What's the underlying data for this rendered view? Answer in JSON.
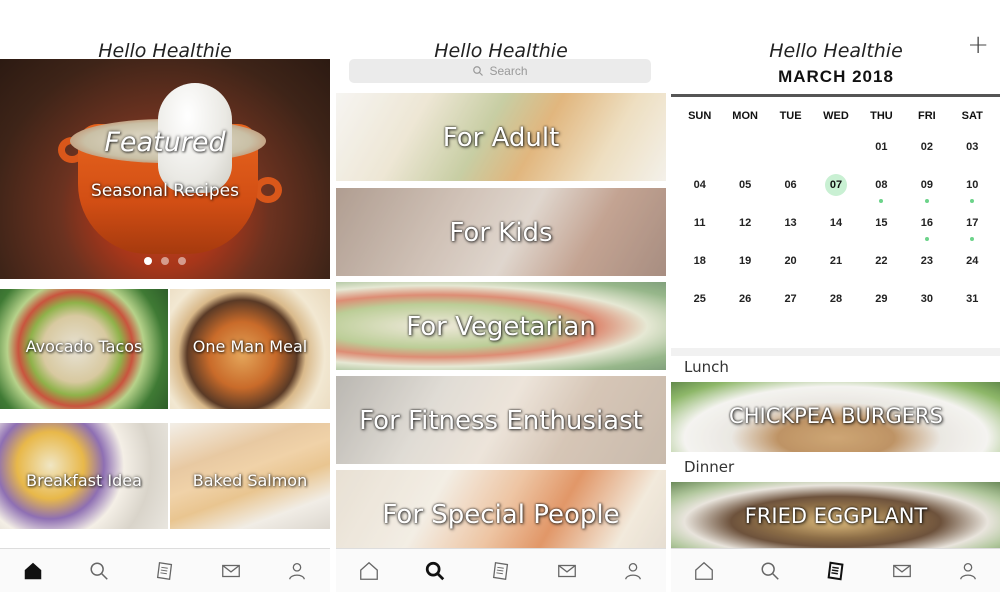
{
  "screens": {
    "home": {
      "title": "Hello Healthie",
      "featured": {
        "title": "Featured",
        "subtitle": "Seasonal Recipes",
        "carousel_pages": 3,
        "active_page": 1
      },
      "tiles": [
        {
          "label": "Avocado Tacos"
        },
        {
          "label": "One Man Meal"
        },
        {
          "label": "Breakfast Idea"
        },
        {
          "label": "Baked Salmon"
        }
      ]
    },
    "search": {
      "title": "Hello Healthie",
      "search_placeholder": "Search",
      "categories": [
        {
          "label": "For Adult"
        },
        {
          "label": "For Kids"
        },
        {
          "label": "For Vegetarian"
        },
        {
          "label": "For Fitness Enthusiast"
        },
        {
          "label": "For Special People"
        }
      ]
    },
    "calendar": {
      "title": "Hello Healthie",
      "add_label": "+",
      "month_label": "MARCH 2018",
      "weekdays": [
        "SUN",
        "MON",
        "TUE",
        "WED",
        "THU",
        "FRI",
        "SAT"
      ],
      "weeks": [
        [
          "",
          "",
          "",
          "",
          "01",
          "02",
          "03"
        ],
        [
          "04",
          "05",
          "06",
          "07",
          "08",
          "09",
          "10"
        ],
        [
          "11",
          "12",
          "13",
          "14",
          "15",
          "16",
          "17"
        ],
        [
          "18",
          "19",
          "20",
          "21",
          "22",
          "23",
          "24"
        ],
        [
          "25",
          "26",
          "27",
          "28",
          "29",
          "30",
          "31"
        ]
      ],
      "today": "07",
      "event_days": [
        "08",
        "09",
        "10",
        "16",
        "17"
      ],
      "meals": [
        {
          "type": "Lunch",
          "dish": "CHICKPEA BURGERS"
        },
        {
          "type": "Dinner",
          "dish": "FRIED EGGPLANT"
        }
      ]
    }
  },
  "tabbar": {
    "tabs": [
      "home-icon",
      "search-icon",
      "recipe-icon",
      "mail-icon",
      "profile-icon"
    ],
    "active": {
      "home": "home-icon",
      "search": "search-icon",
      "calendar": "recipe-icon"
    }
  },
  "colors": {
    "accent_green": "#c9f0d3",
    "event_dot": "#6cd38a"
  }
}
